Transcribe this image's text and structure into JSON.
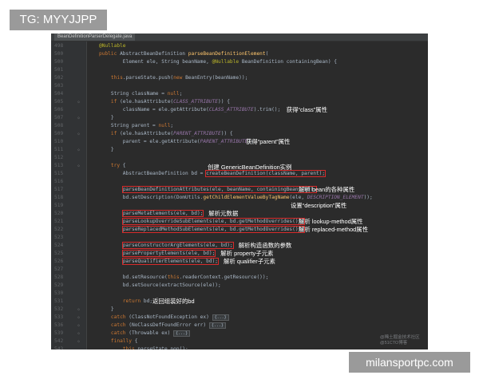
{
  "tag_banner": "TG: MYYJJPP",
  "domain_banner": "milansportpc.com",
  "editor": {
    "tab": "BeanDefinitionParserDelegate.java",
    "watermark": [
      "@稀土掘金技术社区",
      "@51CTO博客"
    ],
    "lines": [
      {
        "ln": "498",
        "fold": "",
        "segs": [
          {
            "t": "@Nullable",
            "c": "ann"
          }
        ]
      },
      {
        "ln": "500",
        "fold": "",
        "segs": [
          {
            "t": "public ",
            "c": "kw"
          },
          {
            "t": "AbstractBeanDefinition "
          },
          {
            "t": "parseBeanDefinitionElement",
            "c": "fn"
          },
          {
            "t": "("
          }
        ]
      },
      {
        "ln": "500",
        "fold": "",
        "segs": [
          {
            "t": "        Element ele, String beanName, "
          },
          {
            "t": "@Nullable",
            "c": "ann"
          },
          {
            "t": " BeanDefinition containingBean) {"
          }
        ]
      },
      {
        "ln": "501",
        "fold": "",
        "segs": []
      },
      {
        "ln": "502",
        "fold": "",
        "segs": [
          {
            "t": "    this",
            "c": "kw"
          },
          {
            "t": ".parseState.push("
          },
          {
            "t": "new ",
            "c": "kw"
          },
          {
            "t": "BeanEntry(beanName));"
          }
        ]
      },
      {
        "ln": "503",
        "fold": "",
        "segs": []
      },
      {
        "ln": "504",
        "fold": "",
        "segs": [
          {
            "t": "    String className = "
          },
          {
            "t": "null",
            "c": "kw"
          },
          {
            "t": ";"
          }
        ]
      },
      {
        "ln": "505",
        "fold": "◇",
        "segs": [
          {
            "t": "    if",
            "c": "kw"
          },
          {
            "t": " (ele.hasAttribute("
          },
          {
            "t": "CLASS_ATTRIBUTE",
            "c": "cst"
          },
          {
            "t": ")) {"
          }
        ]
      },
      {
        "ln": "506",
        "fold": "",
        "segs": [
          {
            "t": "        className = ele.getAttribute("
          },
          {
            "t": "CLASS_ATTRIBUTE",
            "c": "cst"
          },
          {
            "t": ").trim();"
          }
        ],
        "note": "获得“class”属性"
      },
      {
        "ln": "507",
        "fold": "◇",
        "segs": [
          {
            "t": "    }"
          }
        ]
      },
      {
        "ln": "508",
        "fold": "",
        "segs": [
          {
            "t": "    String parent = "
          },
          {
            "t": "null",
            "c": "kw"
          },
          {
            "t": ";"
          }
        ]
      },
      {
        "ln": "509",
        "fold": "◇",
        "segs": [
          {
            "t": "    if",
            "c": "kw"
          },
          {
            "t": " (ele.hasAttribute("
          },
          {
            "t": "PARENT_ATTRIBUTE",
            "c": "cst"
          },
          {
            "t": ")) {"
          }
        ]
      },
      {
        "ln": "510",
        "fold": "",
        "segs": [
          {
            "t": "        parent = ele.getAttribute("
          },
          {
            "t": "PARENT_ATTRIBUTE",
            "c": "cst"
          },
          {
            "t": ");"
          }
        ],
        "note": "获得“parent”属性"
      },
      {
        "ln": "511",
        "fold": "◇",
        "segs": [
          {
            "t": "    }"
          }
        ]
      },
      {
        "ln": "512",
        "fold": "",
        "segs": []
      },
      {
        "ln": "513",
        "fold": "◇",
        "segs": [
          {
            "t": "    try",
            "c": "kw"
          },
          {
            "t": " {"
          }
        ],
        "note_above": "创建 GenericBeanDefinition实例"
      },
      {
        "ln": "515",
        "fold": "",
        "segs": [
          {
            "t": "        AbstractBeanDefinition bd = "
          },
          {
            "t": "createBeanDefinition(className, parent);",
            "box": true
          }
        ]
      },
      {
        "ln": "516",
        "fold": "",
        "segs": []
      },
      {
        "ln": "517",
        "fold": "",
        "segs": [
          {
            "t": "        "
          },
          {
            "t": "parseBeanDefinitionAttributes(ele, beanName, containingBean, bd);",
            "box": true
          }
        ],
        "note": "解析 bean的各种属性"
      },
      {
        "ln": "518",
        "fold": "",
        "segs": [
          {
            "t": "        bd.setDescription(DomUtils."
          },
          {
            "t": "getChildElementValueByTagName",
            "c": "fn"
          },
          {
            "t": "(ele, "
          },
          {
            "t": "DESCRIPTION_ELEMENT",
            "c": "cst"
          },
          {
            "t": "));"
          }
        ]
      },
      {
        "ln": "519",
        "fold": "",
        "segs": [],
        "note": "设置“description”属性"
      },
      {
        "ln": "520",
        "fold": "",
        "segs": [
          {
            "t": "        "
          },
          {
            "t": "parseMetaElements(ele, bd);",
            "box": true
          }
        ],
        "note": "解析元数据"
      },
      {
        "ln": "521",
        "fold": "",
        "segs": [
          {
            "t": "        "
          },
          {
            "t": "parseLookupOverrideSubElements(ele, bd.getMethodOverrides());",
            "box": true
          }
        ],
        "note": "解析 lookup-method属性"
      },
      {
        "ln": "522",
        "fold": "",
        "segs": [
          {
            "t": "        "
          },
          {
            "t": "parseReplacedMethodSubElements(ele, bd.getMethodOverrides());",
            "box": true
          }
        ],
        "note": "解析 replaced-method属性"
      },
      {
        "ln": "523",
        "fold": "",
        "segs": []
      },
      {
        "ln": "524",
        "fold": "",
        "segs": [
          {
            "t": "        "
          },
          {
            "t": "parseConstructorArgElements(ele, bd);",
            "box": true
          }
        ],
        "note": "解析构造函数的参数"
      },
      {
        "ln": "525",
        "fold": "",
        "segs": [
          {
            "t": "        "
          },
          {
            "t": "parsePropertyElements(ele, bd);",
            "box": true
          }
        ],
        "note": "解析 property子元素"
      },
      {
        "ln": "526",
        "fold": "",
        "segs": [
          {
            "t": "        "
          },
          {
            "t": "parseQualifierElements(ele, bd);",
            "box": true
          }
        ],
        "note": "解析 qualifier子元素"
      },
      {
        "ln": "527",
        "fold": "",
        "segs": []
      },
      {
        "ln": "528",
        "fold": "",
        "segs": [
          {
            "t": "        bd.setResource("
          },
          {
            "t": "this",
            "c": "kw"
          },
          {
            "t": ".readerContext.getResource());"
          }
        ]
      },
      {
        "ln": "529",
        "fold": "",
        "segs": [
          {
            "t": "        bd.setSource(extractSource(ele));"
          }
        ]
      },
      {
        "ln": "530",
        "fold": "",
        "segs": []
      },
      {
        "ln": "531",
        "fold": "",
        "segs": [
          {
            "t": "        return",
            "c": "kw"
          },
          {
            "t": " bd;"
          }
        ],
        "note_inline": "返回组装好的bd"
      },
      {
        "ln": "532",
        "fold": "◇",
        "segs": [
          {
            "t": "    }"
          }
        ]
      },
      {
        "ln": "533",
        "fold": "◇",
        "segs": [
          {
            "t": "    catch",
            "c": "kw"
          },
          {
            "t": " (ClassNotFoundException ex) "
          },
          {
            "t": "{...}",
            "fold_box": true
          }
        ]
      },
      {
        "ln": "536",
        "fold": "◇",
        "segs": [
          {
            "t": "    catch",
            "c": "kw"
          },
          {
            "t": " (NoClassDefFoundError err) "
          },
          {
            "t": "{...}",
            "fold_box": true
          }
        ]
      },
      {
        "ln": "539",
        "fold": "◇",
        "segs": [
          {
            "t": "    catch",
            "c": "kw"
          },
          {
            "t": " (Throwable ex) "
          },
          {
            "t": "{...}",
            "fold_box": true
          }
        ]
      },
      {
        "ln": "542",
        "fold": "◇",
        "segs": [
          {
            "t": "    finally",
            "c": "kw"
          },
          {
            "t": " {"
          }
        ]
      },
      {
        "ln": "543",
        "fold": "",
        "segs": [
          {
            "t": "        this",
            "c": "kw"
          },
          {
            "t": ".parseState.pop();"
          }
        ]
      }
    ]
  }
}
